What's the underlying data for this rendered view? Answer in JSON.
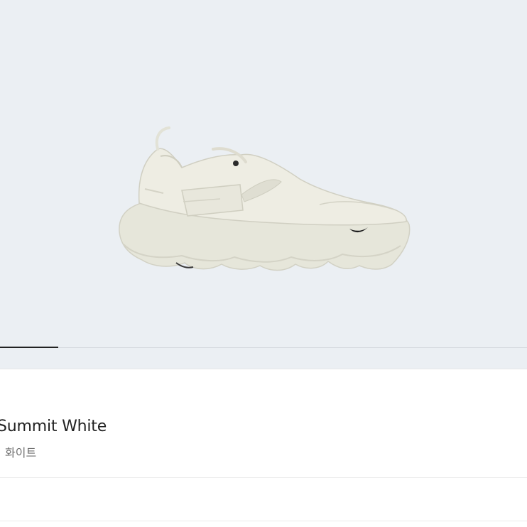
{
  "product": {
    "name": "Summit White",
    "subtitle": "화이트"
  },
  "gallery": {
    "image": "white-sneaker-image",
    "slide_progress": 0.11
  },
  "colors": {
    "gallery_bg": "#ebeff3",
    "shoe_body": "#ecebe0",
    "indicator_active": "#222222"
  }
}
